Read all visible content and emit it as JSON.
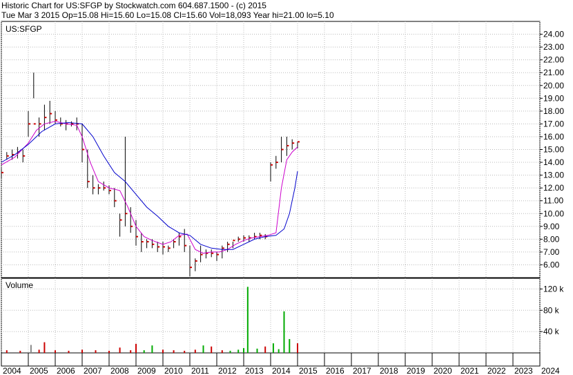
{
  "header": {
    "line1": "Historic Chart for US:SFGP by Stockwatch.com 604.687.1500 - (c) 2015",
    "line2": "Tue Mar  3 2015  Op=15.08  Hi=15.60  Lo=15.08  Cl=15.60  Vol=18,093  Year hi=21.00  lo=5.10"
  },
  "colors": {
    "price_bar": "#000000",
    "up_marker": "#cc0000",
    "ma_short": "#cc00cc",
    "ma_long": "#0000cc",
    "volume_up": "#00aa00",
    "volume_down": "#cc0000",
    "volume_neutral": "#888888",
    "grid": "#b8b8b8"
  },
  "chart_data": [
    {
      "type": "line",
      "label": "US:SFGP",
      "ylim": [
        5,
        25
      ],
      "xlim": [
        2004,
        2024
      ],
      "yticks": [
        "24.00",
        "23.00",
        "22.00",
        "21.00",
        "20.00",
        "19.00",
        "18.00",
        "17.00",
        "16.00",
        "15.00",
        "14.00",
        "13.00",
        "12.00",
        "11.00",
        "10.00",
        "9.00",
        "8.00",
        "7.00",
        "6.00"
      ],
      "ytick_values": [
        24,
        23,
        22,
        21,
        20,
        19,
        18,
        17,
        16,
        15,
        14,
        13,
        12,
        11,
        10,
        9,
        8,
        7,
        6
      ],
      "grid": true,
      "series": [
        {
          "style": "ohlc",
          "x": [
            2004.0,
            2004.2,
            2004.4,
            2004.6,
            2004.8,
            2005.0,
            2005.2,
            2005.4,
            2005.6,
            2005.8,
            2006.0,
            2006.2,
            2006.4,
            2006.6,
            2006.8,
            2007.0,
            2007.2,
            2007.4,
            2007.6,
            2007.8,
            2008.0,
            2008.2,
            2008.4,
            2008.6,
            2008.8,
            2009.0,
            2009.2,
            2009.4,
            2009.6,
            2009.8,
            2010.0,
            2010.2,
            2010.4,
            2010.6,
            2010.8,
            2011.0,
            2011.2,
            2011.4,
            2011.6,
            2011.8,
            2012.0,
            2012.2,
            2012.4,
            2012.6,
            2012.8,
            2013.0,
            2013.2,
            2013.4,
            2013.6,
            2013.8,
            2014.0,
            2014.2,
            2014.4,
            2014.6,
            2014.8,
            2015.0
          ],
          "high": [
            13.5,
            14.8,
            15.0,
            15.2,
            15.0,
            18.0,
            21.0,
            17.5,
            18.5,
            18.8,
            18.0,
            17.5,
            17.3,
            17.2,
            17.5,
            17.0,
            15.0,
            13.0,
            12.3,
            12.5,
            12.2,
            12.0,
            10.0,
            16.0,
            10.5,
            9.5,
            8.5,
            8.0,
            8.0,
            7.8,
            7.8,
            7.5,
            8.0,
            8.5,
            8.8,
            7.5,
            6.5,
            7.5,
            7.2,
            7.2,
            7.0,
            7.5,
            7.8,
            7.8,
            8.2,
            8.3,
            8.3,
            8.5,
            8.5,
            8.4,
            14.0,
            14.5,
            16.0,
            16.0,
            15.8,
            15.6
          ],
          "low": [
            12.8,
            14.2,
            14.2,
            14.3,
            14.0,
            16.0,
            19.0,
            16.0,
            16.5,
            17.0,
            17.0,
            16.8,
            16.5,
            16.8,
            16.5,
            14.0,
            12.0,
            11.5,
            11.5,
            11.8,
            11.5,
            10.5,
            8.2,
            9.0,
            8.5,
            7.5,
            7.0,
            7.3,
            7.3,
            7.0,
            6.8,
            7.0,
            7.3,
            7.5,
            7.0,
            5.1,
            5.5,
            6.2,
            6.5,
            6.6,
            6.3,
            6.5,
            7.0,
            7.3,
            7.8,
            7.8,
            7.8,
            8.0,
            8.0,
            8.0,
            12.5,
            13.5,
            14.0,
            14.5,
            15.0,
            15.08
          ],
          "close": [
            13.2,
            14.5,
            14.6,
            14.8,
            14.5,
            17.0,
            17.0,
            17.0,
            17.5,
            17.8,
            17.3,
            17.0,
            17.0,
            17.0,
            17.0,
            15.0,
            12.5,
            12.0,
            12.0,
            12.0,
            11.8,
            11.0,
            9.5,
            10.0,
            9.0,
            8.2,
            7.8,
            7.8,
            7.6,
            7.4,
            7.4,
            7.3,
            7.8,
            8.2,
            7.5,
            5.8,
            6.3,
            6.8,
            6.9,
            6.9,
            6.8,
            7.3,
            7.6,
            7.9,
            8.0,
            8.1,
            8.1,
            8.2,
            8.3,
            8.2,
            13.8,
            14.0,
            15.0,
            15.3,
            15.5,
            15.6
          ]
        },
        {
          "style": "moving_average_short",
          "x": [
            2004.0,
            2004.5,
            2005.0,
            2005.3,
            2005.6,
            2006.0,
            2006.4,
            2006.8,
            2007.0,
            2007.3,
            2007.6,
            2008.0,
            2008.4,
            2008.7,
            2009.0,
            2009.3,
            2009.6,
            2010.0,
            2010.3,
            2010.6,
            2010.9,
            2011.2,
            2011.5,
            2011.8,
            2012.1,
            2012.4,
            2012.7,
            2013.0,
            2013.3,
            2013.6,
            2013.9,
            2014.2,
            2014.4,
            2014.6,
            2014.8,
            2015.0
          ],
          "y": [
            13.8,
            14.4,
            15.5,
            16.5,
            17.0,
            17.2,
            17.0,
            16.9,
            16.0,
            14.0,
            12.5,
            12.0,
            11.8,
            10.5,
            9.0,
            8.2,
            7.9,
            7.6,
            7.8,
            8.3,
            8.4,
            7.2,
            6.9,
            7.0,
            7.0,
            7.2,
            7.6,
            7.9,
            8.1,
            8.2,
            8.3,
            8.5,
            12.0,
            14.2,
            14.8,
            15.2
          ]
        },
        {
          "style": "moving_average_long",
          "x": [
            2004.0,
            2004.5,
            2005.0,
            2005.5,
            2006.0,
            2006.5,
            2007.0,
            2007.4,
            2007.8,
            2008.2,
            2008.6,
            2009.0,
            2009.4,
            2009.8,
            2010.2,
            2010.6,
            2011.0,
            2011.4,
            2011.8,
            2012.2,
            2012.6,
            2013.0,
            2013.4,
            2013.8,
            2014.2,
            2014.5,
            2014.7,
            2014.9,
            2015.0
          ],
          "y": [
            14.0,
            14.6,
            15.4,
            16.4,
            17.0,
            17.1,
            17.0,
            16.0,
            14.5,
            13.2,
            12.5,
            11.5,
            10.5,
            9.8,
            9.0,
            8.5,
            8.3,
            7.6,
            7.3,
            7.2,
            7.2,
            7.6,
            8.0,
            8.2,
            8.3,
            8.8,
            10.0,
            12.0,
            13.3
          ]
        }
      ]
    },
    {
      "type": "bar",
      "label": "Volume",
      "ylim": [
        0,
        140000
      ],
      "yticks": [
        "120 k",
        "80 k",
        "40 k"
      ],
      "ytick_values": [
        120000,
        80000,
        40000
      ],
      "xticks": [
        "2004",
        "2005",
        "2006",
        "2007",
        "2008",
        "2009",
        "2010",
        "2011",
        "2012",
        "2013",
        "2014",
        "2015",
        "2016",
        "2017",
        "2018",
        "2019",
        "2020",
        "2021",
        "2022",
        "2023",
        "2024"
      ],
      "xtick_values": [
        2004,
        2005,
        2006,
        2007,
        2008,
        2009,
        2010,
        2011,
        2012,
        2013,
        2014,
        2015,
        2016,
        2017,
        2018,
        2019,
        2020,
        2021,
        2022,
        2023,
        2024
      ],
      "series": [
        {
          "x": [
            2004.2,
            2004.7,
            2005.1,
            2005.4,
            2005.6,
            2006.0,
            2006.5,
            2007.0,
            2007.5,
            2008.0,
            2008.4,
            2008.8,
            2009.0,
            2009.3,
            2009.6,
            2010.0,
            2010.4,
            2010.8,
            2011.2,
            2011.5,
            2011.8,
            2012.2,
            2012.5,
            2012.8,
            2013.0,
            2013.15,
            2013.5,
            2013.8,
            2014.1,
            2014.3,
            2014.5,
            2014.7,
            2015.0
          ],
          "y": [
            5000,
            4000,
            15000,
            6000,
            20000,
            5000,
            4000,
            6000,
            5000,
            4000,
            10000,
            5000,
            17000,
            5000,
            14000,
            6000,
            5000,
            4000,
            6000,
            14000,
            12000,
            5000,
            4000,
            6000,
            9000,
            124000,
            8000,
            12000,
            18000,
            7000,
            78000,
            26000,
            18000
          ],
          "direction": [
            "down",
            "down",
            "neutral",
            "down",
            "down",
            "down",
            "down",
            "down",
            "down",
            "down",
            "down",
            "down",
            "down",
            "up",
            "up",
            "down",
            "down",
            "down",
            "down",
            "up",
            "down",
            "down",
            "up",
            "up",
            "up",
            "up",
            "up",
            "down",
            "up",
            "up",
            "up",
            "up",
            "down"
          ]
        }
      ]
    }
  ]
}
